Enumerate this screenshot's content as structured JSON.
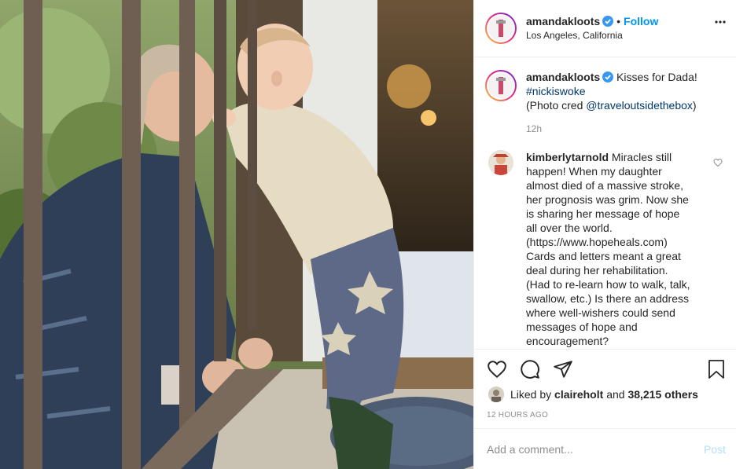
{
  "post": {
    "author": "amandakloots",
    "follow_label": "Follow",
    "location": "Los Angeles, California",
    "more_icon": "more-horizontal-icon",
    "separator": "•"
  },
  "caption": {
    "username": "amandakloots",
    "line1": "Kisses for Dada!",
    "hashtag": "#nickiswoke",
    "credit_prefix": "(Photo cred ",
    "credit_handle": "@traveloutsidethebox",
    "credit_suffix": ")",
    "time": "12h"
  },
  "comments": [
    {
      "username": "kimberlytarnold",
      "text": "Miracles still happen! When my daughter almost died of a massive stroke, her prognosis was grim. Now she is sharing her message of hope all over the world. (https://www.hopeheals.com) Cards and letters meant a great deal during her rehabilitation. (Had to re-learn how to walk, talk, swallow, etc.) Is there an address where well-wishers could send messages of hope and encouragement?"
    }
  ],
  "likes": {
    "prefix": "Liked by ",
    "user": "claireholt",
    "middle": " and ",
    "count": "38,215 others"
  },
  "timestamp": "12 HOURS AGO",
  "add_comment": {
    "placeholder": "Add a comment...",
    "post_label": "Post"
  },
  "colors": {
    "accent": "#0095f6",
    "post_disabled": "#b2dffc",
    "hashtag": "#00376b",
    "muted": "#8e8e8e"
  }
}
